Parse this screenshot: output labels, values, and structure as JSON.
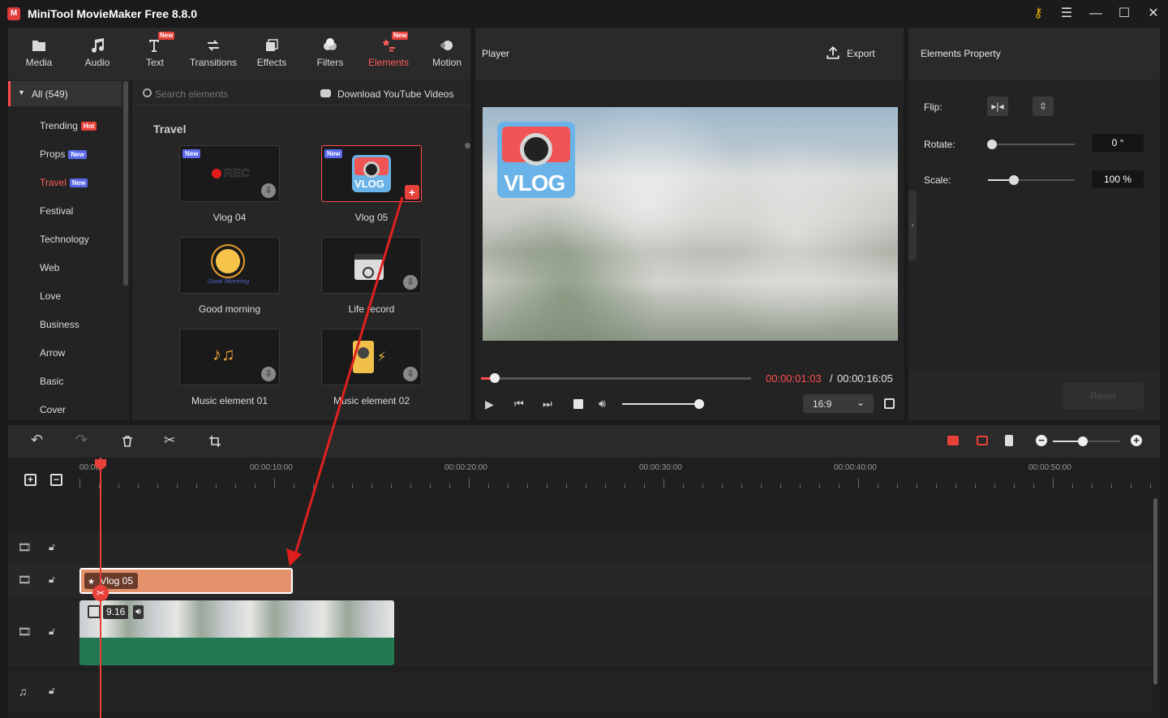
{
  "app": {
    "title": "MiniTool MovieMaker Free 8.8.0"
  },
  "toolbar": {
    "tabs": [
      {
        "label": "Media",
        "icon": "folder-icon"
      },
      {
        "label": "Audio",
        "icon": "music-note-icon"
      },
      {
        "label": "Text",
        "icon": "text-icon",
        "badge": "New"
      },
      {
        "label": "Transitions",
        "icon": "transitions-icon"
      },
      {
        "label": "Effects",
        "icon": "effects-icon"
      },
      {
        "label": "Filters",
        "icon": "filters-icon"
      },
      {
        "label": "Elements",
        "icon": "elements-icon",
        "badge": "New",
        "active": true
      },
      {
        "label": "Motion",
        "icon": "motion-icon"
      }
    ]
  },
  "sidebar": {
    "all_label": "All (549)",
    "items": [
      {
        "label": "Trending",
        "badge": "Hot"
      },
      {
        "label": "Props",
        "badge": "New"
      },
      {
        "label": "Travel",
        "badge": "New",
        "active": true
      },
      {
        "label": "Festival"
      },
      {
        "label": "Technology"
      },
      {
        "label": "Web"
      },
      {
        "label": "Love"
      },
      {
        "label": "Business"
      },
      {
        "label": "Arrow"
      },
      {
        "label": "Basic"
      },
      {
        "label": "Cover"
      }
    ]
  },
  "content": {
    "search_placeholder": "Search elements",
    "download_youtube": "Download YouTube Videos",
    "section_title": "Travel",
    "cards": [
      {
        "label": "Vlog 04",
        "badge": "New",
        "thumb_text": "REC"
      },
      {
        "label": "Vlog 05",
        "badge": "New",
        "thumb_text": "VLOG"
      },
      {
        "label": "Good morning",
        "thumb_text": "Good Morning"
      },
      {
        "label": "Life record"
      },
      {
        "label": "Music element 01"
      },
      {
        "label": "Music element 02"
      }
    ]
  },
  "player": {
    "title": "Player",
    "export_label": "Export",
    "overlay_text": "VLOG",
    "current_time": "00:00:01:03",
    "separator": "/",
    "total_time": "00:00:16:05",
    "aspect_ratio": "16:9",
    "progress_fraction": 0.05,
    "volume_fraction": 1.0
  },
  "properties": {
    "title": "Elements Property",
    "flip_label": "Flip:",
    "rotate_label": "Rotate:",
    "rotate_value": "0 °",
    "rotate_fraction": 0.0,
    "scale_label": "Scale:",
    "scale_value": "100 %",
    "scale_fraction": 0.3,
    "reset_label": "Reset"
  },
  "timeline": {
    "zoom_fraction": 0.45,
    "ruler_labels": [
      "00:00",
      "00:00:10:00",
      "00:00:20:00",
      "00:00:30:00",
      "00:00:40:00",
      "00:00:50:00"
    ],
    "element_clip": {
      "label": "Vlog 05"
    },
    "video_clip": {
      "speed_label": "9.16"
    }
  },
  "colors": {
    "accent": "#ff4d4d",
    "element_clip": "#e3926b",
    "audio_bar": "#217a52",
    "badge_new": "#5868e8"
  }
}
